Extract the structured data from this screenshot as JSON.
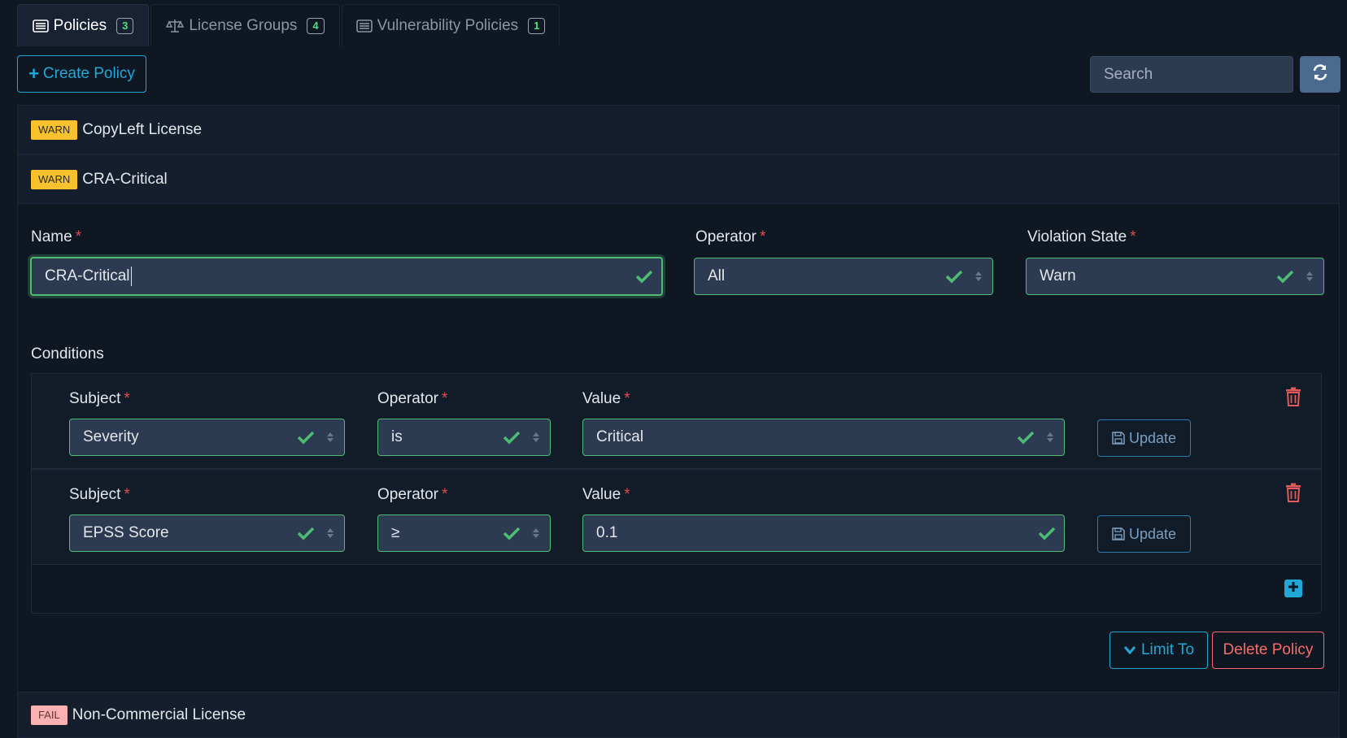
{
  "tabs": [
    {
      "label": "Policies",
      "count": "3",
      "icon": "list-icon",
      "active": true
    },
    {
      "label": "License Groups",
      "count": "4",
      "icon": "balance-scale-icon",
      "active": false
    },
    {
      "label": "Vulnerability Policies",
      "count": "1",
      "icon": "list-icon",
      "active": false
    }
  ],
  "toolbar": {
    "create_label": "Create Policy",
    "search_placeholder": "Search"
  },
  "policies": [
    {
      "state": "WARN",
      "name": "CopyLeft License"
    },
    {
      "state": "WARN",
      "name": "CRA-Critical"
    },
    {
      "state": "FAIL",
      "name": "Non-Commercial License"
    }
  ],
  "form": {
    "name_label": "Name",
    "name_value": "CRA-Critical",
    "operator_label": "Operator",
    "operator_value": "All",
    "violation_label": "Violation State",
    "violation_value": "Warn",
    "conditions_label": "Conditions",
    "required_mark": "*"
  },
  "conditions": [
    {
      "subject_label": "Subject",
      "subject": "Severity",
      "operator_label": "Operator",
      "operator": "is",
      "value_label": "Value",
      "value": "Critical",
      "update_label": "Update"
    },
    {
      "subject_label": "Subject",
      "subject": "EPSS Score",
      "operator_label": "Operator",
      "operator": "≥",
      "value_label": "Value",
      "value": "0.1",
      "update_label": "Update"
    }
  ],
  "actions": {
    "limit_label": "Limit To",
    "delete_label": "Delete Policy"
  },
  "colors": {
    "background": "#0f1722",
    "accent": "#20a8d8",
    "success": "#4dbd74",
    "danger": "#f86c6b",
    "warn": "#f8c22e"
  }
}
